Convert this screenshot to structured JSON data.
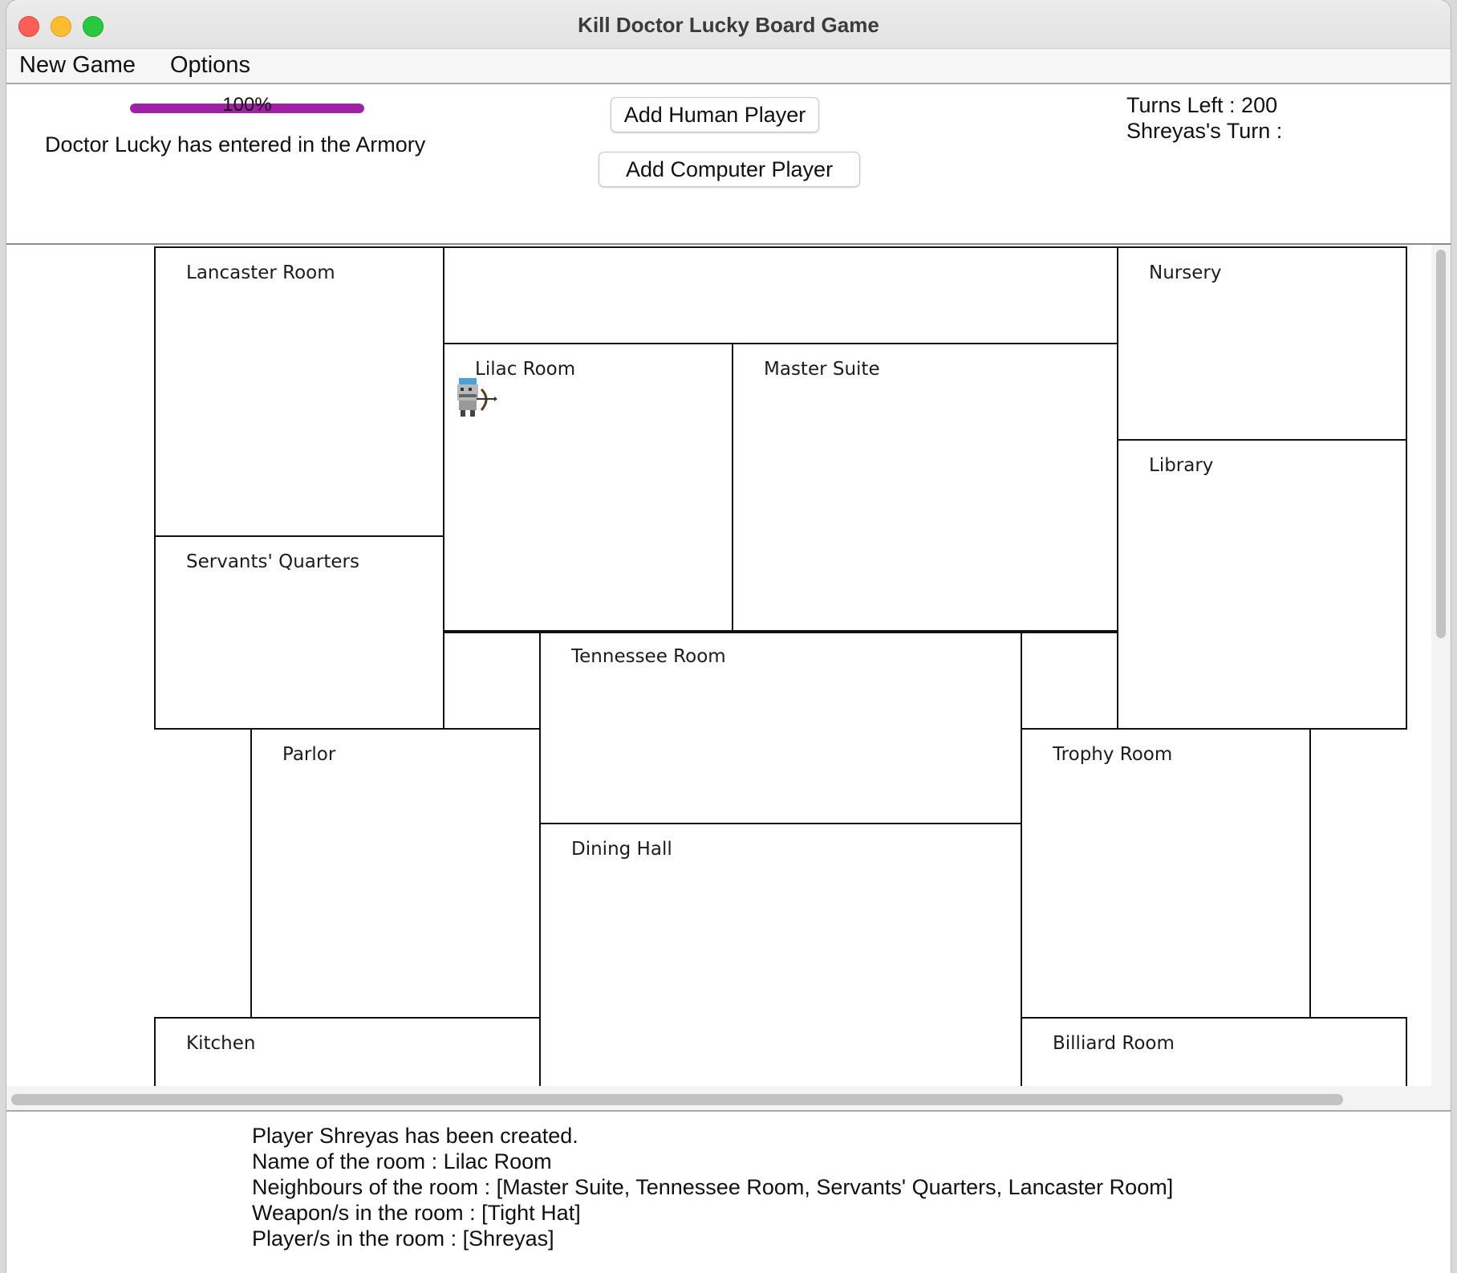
{
  "window": {
    "title": "Kill Doctor Lucky Board Game"
  },
  "menu": {
    "new_game": "New Game",
    "options": "Options"
  },
  "status": {
    "progress_value": 100,
    "progress_label": "100%",
    "doctor_message": "Doctor Lucky has entered in the Armory",
    "turns_left": "Turns Left : 200",
    "current_turn": "Shreyas's Turn :"
  },
  "buttons": {
    "add_human": "Add Human Player",
    "add_computer": "Add Computer Player"
  },
  "board": {
    "rooms": [
      {
        "key": "lancaster-room",
        "name": "Lancaster Room"
      },
      {
        "key": "nursery",
        "name": "Nursery"
      },
      {
        "key": "lilac-room",
        "name": "Lilac Room"
      },
      {
        "key": "master-suite",
        "name": "Master Suite"
      },
      {
        "key": "library",
        "name": "Library"
      },
      {
        "key": "servants-quarters",
        "name": "Servants' Quarters"
      },
      {
        "key": "tennessee-room",
        "name": "Tennessee Room"
      },
      {
        "key": "parlor",
        "name": "Parlor"
      },
      {
        "key": "trophy-room",
        "name": "Trophy Room"
      },
      {
        "key": "dining-hall",
        "name": "Dining Hall"
      },
      {
        "key": "kitchen",
        "name": "Kitchen"
      },
      {
        "key": "billiard-room",
        "name": "Billiard Room"
      }
    ],
    "player_token_icon": "archer-player-icon",
    "player_token_room": "Lilac Room"
  },
  "log": {
    "lines": [
      "Player Shreyas has been created.",
      "Name of the room : Lilac Room",
      "Neighbours of the room : [Master Suite, Tennessee Room, Servants' Quarters, Lancaster Room]",
      "Weapon/s in the room : [Tight Hat]",
      "Player/s in the room : [Shreyas]"
    ]
  },
  "colors": {
    "progress": "#a020a8"
  }
}
